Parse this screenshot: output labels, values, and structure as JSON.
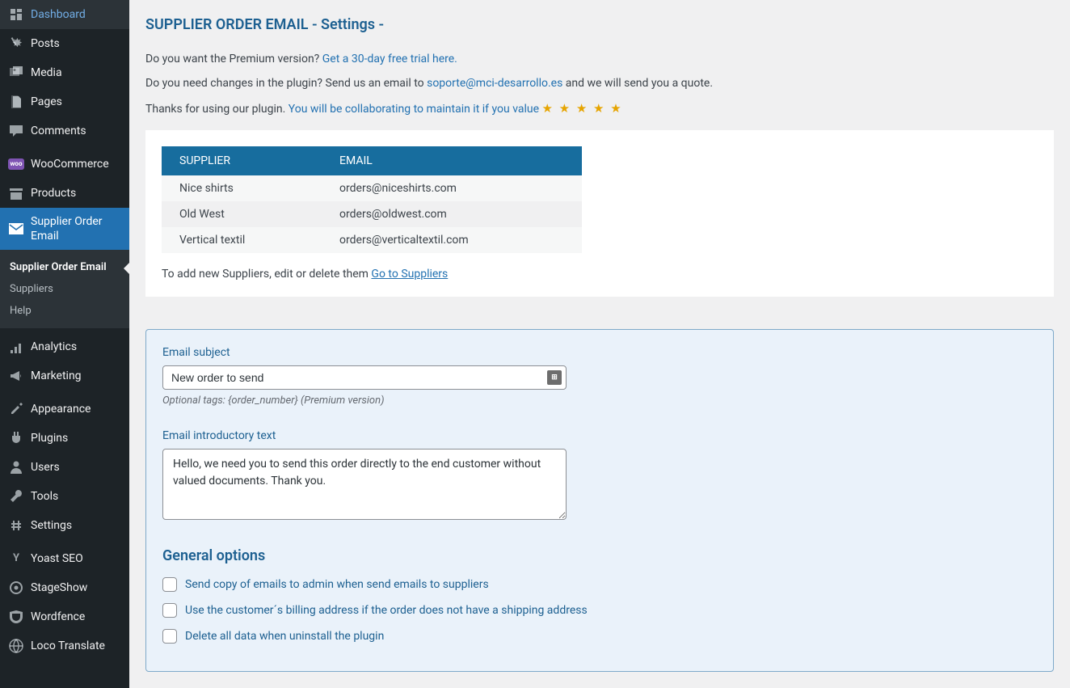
{
  "sidebar": {
    "items": [
      {
        "id": "dashboard",
        "label": "Dashboard",
        "icon": "◕"
      },
      {
        "id": "posts",
        "label": "Posts",
        "icon": "📌"
      },
      {
        "id": "media",
        "label": "Media",
        "icon": "🖼"
      },
      {
        "id": "pages",
        "label": "Pages",
        "icon": "📄"
      },
      {
        "id": "comments",
        "label": "Comments",
        "icon": "💬"
      },
      {
        "id": "woocommerce",
        "label": "WooCommerce",
        "icon": "woo"
      },
      {
        "id": "products",
        "label": "Products",
        "icon": "🗄"
      },
      {
        "id": "supplier-order-email",
        "label": "Supplier Order Email",
        "icon": "✉",
        "active": true
      },
      {
        "id": "analytics",
        "label": "Analytics",
        "icon": "📊"
      },
      {
        "id": "marketing",
        "label": "Marketing",
        "icon": "📣"
      },
      {
        "id": "appearance",
        "label": "Appearance",
        "icon": "🖌"
      },
      {
        "id": "plugins",
        "label": "Plugins",
        "icon": "🔌"
      },
      {
        "id": "users",
        "label": "Users",
        "icon": "👤"
      },
      {
        "id": "tools",
        "label": "Tools",
        "icon": "🔧"
      },
      {
        "id": "settings",
        "label": "Settings",
        "icon": "⚙"
      },
      {
        "id": "yoast",
        "label": "Yoast SEO",
        "icon": "Y"
      },
      {
        "id": "stageshow",
        "label": "StageShow",
        "icon": "✳"
      },
      {
        "id": "wordfence",
        "label": "Wordfence",
        "icon": "🛡"
      },
      {
        "id": "loco",
        "label": "Loco Translate",
        "icon": "🌐"
      }
    ],
    "submenu": [
      {
        "id": "supplier-order-email",
        "label": "Supplier Order Email",
        "current": true
      },
      {
        "id": "suppliers",
        "label": "Suppliers"
      },
      {
        "id": "help",
        "label": "Help"
      }
    ]
  },
  "page": {
    "title": "SUPPLIER ORDER EMAIL - Settings -"
  },
  "intro": {
    "premium_text": "Do you want the Premium version? ",
    "premium_link": "Get a 30-day free trial here.",
    "changes_text_1": "Do you need changes in the plugin? Send us an email to ",
    "changes_email": "soporte@mci-desarrollo.es",
    "changes_text_2": " and we will send you a quote.",
    "thanks_text": "Thanks for using our plugin. ",
    "collab_link": "You will be collaborating to maintain it if you value ",
    "stars": "★ ★ ★ ★ ★"
  },
  "supplier_table": {
    "headers": {
      "supplier": "SUPPLIER",
      "email": "EMAIL"
    },
    "rows": [
      {
        "supplier": "Nice shirts",
        "email": "orders@niceshirts.com"
      },
      {
        "supplier": "Old West",
        "email": "orders@oldwest.com"
      },
      {
        "supplier": "Vertical textil",
        "email": "orders@verticaltextil.com"
      }
    ],
    "add_note_text": "To add new Suppliers, edit or delete them ",
    "add_note_link": "Go to Suppliers"
  },
  "form": {
    "email_subject_label": "Email subject",
    "email_subject_value": "New order to send",
    "email_subject_hint": "Optional tags: {order_number} (Premium version)",
    "intro_text_label": "Email introductory text",
    "intro_text_value": "Hello, we need you to send this order directly to the end customer without valued documents. Thank you.",
    "general_heading": "General options",
    "options": [
      {
        "id": "copy-admin",
        "label": "Send copy of emails to admin when send emails to suppliers"
      },
      {
        "id": "billing-addr",
        "label": "Use the customer´s billing address if the order does not have a shipping address"
      },
      {
        "id": "delete-data",
        "label": "Delete all data when uninstall the plugin"
      }
    ]
  }
}
